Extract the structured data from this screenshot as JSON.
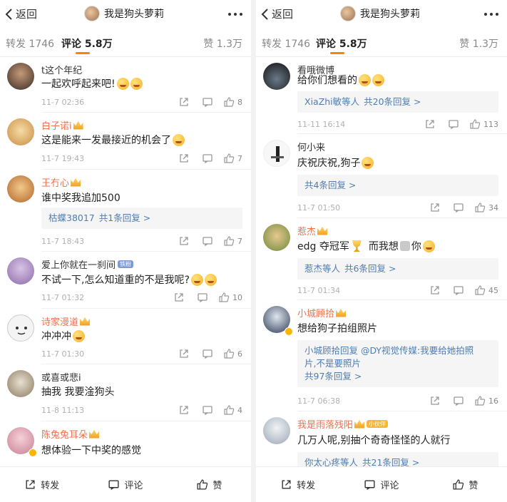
{
  "left": {
    "header": {
      "back_label": "返回",
      "title": "我是狗头萝莉"
    },
    "tabs": {
      "repost": "转发 1746",
      "comments": "评论 5.8万",
      "likes": "赞 1.3万"
    },
    "comments": [
      {
        "name": "t这个年纪",
        "text": "一起欢呼起来吧!",
        "time": "11-7 02:36",
        "likes": "8"
      },
      {
        "name": "白子诺i",
        "text": "这是能来一发最接近的机会了",
        "time": "11-7 19:43",
        "likes": "7"
      },
      {
        "name": "王冇心",
        "text": "谁中奖我追加500",
        "reply_user": "枯蝶38017",
        "reply_count": "共1条回复 >",
        "time": "11-7 18:43",
        "likes": "7"
      },
      {
        "name": "爱上你就在一刹间",
        "tag": "铁粉",
        "text": "不试一下,怎么知道重的不是我呢?",
        "time": "11-7 01:32",
        "likes": "10"
      },
      {
        "name": "诗家漫道",
        "text": "冲冲冲",
        "time": "11-7 01:30",
        "likes": "6"
      },
      {
        "name": "或喜或悲i",
        "text": "抽我 我要淦狗头",
        "time": "11-8 11:13",
        "likes": "4"
      },
      {
        "name": "陈兔兔耳朵",
        "text": "想体验一下中奖的感觉"
      }
    ]
  },
  "right": {
    "header": {
      "back_label": "返回",
      "title": "我是狗头萝莉"
    },
    "tabs": {
      "repost": "转发 1746",
      "comments": "评论 5.8万",
      "likes": "赞 1.3万"
    },
    "comments": [
      {
        "name": "看哦微博",
        "text": "给你们想看的",
        "reply_user": "XiaZhi敏等人",
        "reply_count": "共20条回复 >",
        "time": "11-11 16:14",
        "likes": "113"
      },
      {
        "name": "何小来",
        "text": "庆祝庆祝,狗子",
        "reply_count": "共4条回复 >",
        "time": "11-7 01:50",
        "likes": "34"
      },
      {
        "name": "惹杰",
        "text_a": "edg 夺冠军",
        "text_b": "而我想",
        "text_c": "你",
        "reply_user": "惹杰等人",
        "reply_count": "共6条回复 >",
        "time": "11-7 01:34",
        "likes": "45"
      },
      {
        "name": "小城顾拾",
        "text": "想给狗子拍组照片",
        "reply_line1": "小城顾拾回复 @DY视觉传媒:我要给她拍照",
        "reply_line2": "片,不是要照片",
        "reply_count": "共97条回复 >",
        "time": "11-7 06:38",
        "likes": "16"
      },
      {
        "name": "我是雨落残阳",
        "tag": "小伙伴",
        "text": "几万人呢,别抽个奇奇怪怪的人就行",
        "reply_user": "你太心疼等人",
        "reply_count": "共21条回复 >"
      }
    ]
  },
  "bottombar": {
    "repost": "转发",
    "comment": "评论",
    "like": "赞"
  }
}
